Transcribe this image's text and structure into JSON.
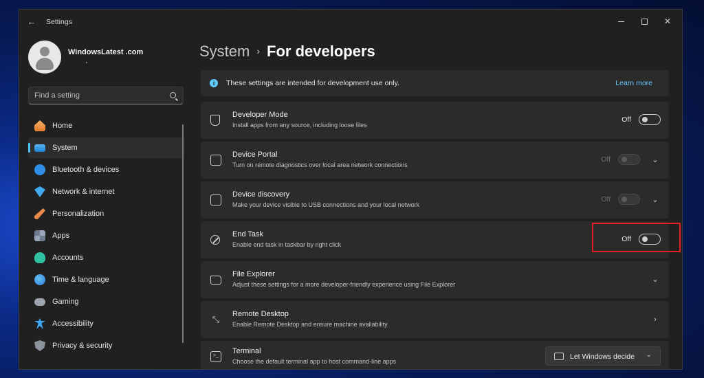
{
  "window": {
    "title": "Settings"
  },
  "profile": {
    "name": "WindowsLatest .com"
  },
  "search": {
    "placeholder": "Find a setting"
  },
  "sidebar": {
    "items": [
      {
        "label": "Home",
        "icon": "home-icon"
      },
      {
        "label": "System",
        "icon": "system-icon",
        "active": true
      },
      {
        "label": "Bluetooth & devices",
        "icon": "bluetooth-icon"
      },
      {
        "label": "Network & internet",
        "icon": "wifi-icon"
      },
      {
        "label": "Personalization",
        "icon": "brush-icon"
      },
      {
        "label": "Apps",
        "icon": "apps-icon"
      },
      {
        "label": "Accounts",
        "icon": "person-icon"
      },
      {
        "label": "Time & language",
        "icon": "globe-clock-icon"
      },
      {
        "label": "Gaming",
        "icon": "gamepad-icon"
      },
      {
        "label": "Accessibility",
        "icon": "accessibility-icon"
      },
      {
        "label": "Privacy & security",
        "icon": "shield-icon"
      }
    ]
  },
  "breadcrumb": {
    "parent": "System",
    "separator": "›",
    "current": "For developers"
  },
  "info_bar": {
    "text": "These settings are intended for development use only.",
    "link": "Learn more"
  },
  "settings": [
    {
      "title": "Developer Mode",
      "desc": "Install apps from any source, including loose files",
      "state": "Off",
      "icon": "developer-tools-icon"
    },
    {
      "title": "Device Portal",
      "desc": "Turn on remote diagnostics over local area network connections",
      "state": "Off",
      "icon": "device-portal-icon"
    },
    {
      "title": "Device discovery",
      "desc": "Make your device visible to USB connections and your local network",
      "state": "Off",
      "icon": "device-discovery-icon"
    },
    {
      "title": "End Task",
      "desc": "Enable end task in taskbar by right click",
      "state": "Off",
      "icon": "end-task-icon"
    },
    {
      "title": "File Explorer",
      "desc": "Adjust these settings for a more developer-friendly experience using File Explorer",
      "icon": "folder-icon"
    },
    {
      "title": "Remote Desktop",
      "desc": "Enable Remote Desktop and ensure machine availability",
      "icon": "remote-desktop-icon"
    },
    {
      "title": "Terminal",
      "desc": "Choose the default terminal app to host command-line apps",
      "dropdown": "Let Windows decide",
      "icon": "terminal-icon"
    }
  ],
  "colors": {
    "accent": "#4cc2ff",
    "link": "#6ccaff",
    "highlight": "#e21d2c",
    "window_bg": "#202020",
    "card_bg": "#2b2b2b"
  }
}
